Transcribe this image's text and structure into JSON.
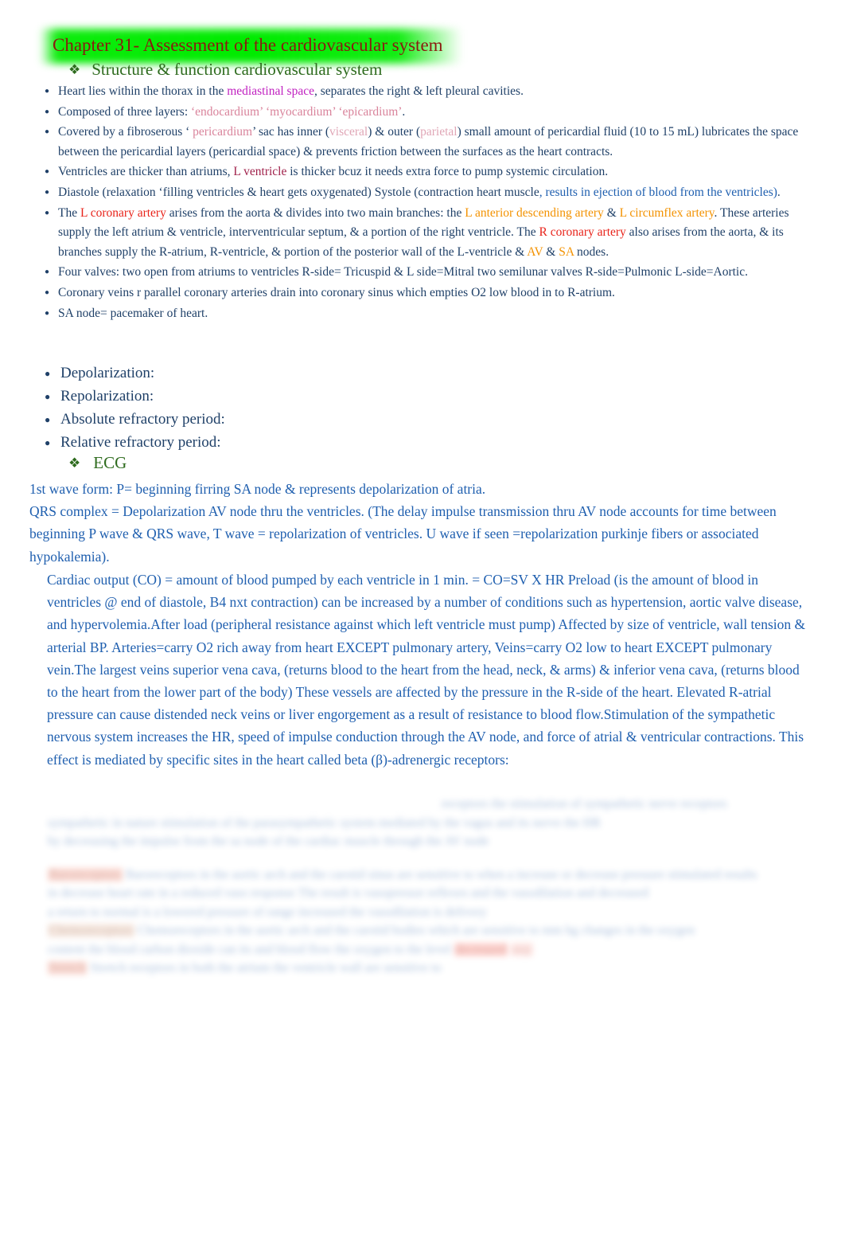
{
  "document": {
    "title": "Chapter 31-  Assessment of the cardiovascular system",
    "title_text_color": "#8B1A10",
    "title_highlight_color": "#00EB00",
    "body_text_color": "#1F4068",
    "paragraph_text_color": "#1F5FAF"
  },
  "headings": {
    "structure": {
      "bullet_icon": "diamond-bullet-icon",
      "label": "Structure & function cardiovascular system",
      "color": "#2E6B1E"
    },
    "ecg": {
      "bullet_icon": "diamond-bullet-icon",
      "label": "ECG",
      "color": "#2E6B1E"
    }
  },
  "bullets": [
    {
      "id": "heart-location",
      "parts": [
        {
          "text": "Heart lies within the thorax in the ",
          "color": "navy"
        },
        {
          "text": "mediastinal space",
          "color": "magenta"
        },
        {
          "text": ", separates the right & left pleural cavities.",
          "color": "navy"
        }
      ]
    },
    {
      "id": "three-layers",
      "parts": [
        {
          "text": "Composed of three layers: ",
          "color": "navy"
        },
        {
          "text": "‘endocardium’ ‘myocardium’ ‘epicardium’",
          "color": "pink"
        },
        {
          "text": ".",
          "color": "navy"
        }
      ]
    },
    {
      "id": "pericardium",
      "parts": [
        {
          "text": "Covered by a fibroserous ‘ ",
          "color": "navy"
        },
        {
          "text": "pericardium",
          "color": "pink"
        },
        {
          "text": "’ sac has inner (",
          "color": "navy"
        },
        {
          "text": "visceral",
          "color": "pink-lt"
        },
        {
          "text": ") & outer (",
          "color": "navy"
        },
        {
          "text": "parietal",
          "color": "pink-lt"
        },
        {
          "text": ") small amount of pericardial fluid (10 to 15 mL) lubricates the space between the pericardial layers (pericardial space)  & prevents friction between the surfaces as the heart contracts.",
          "color": "navy"
        }
      ]
    },
    {
      "id": "ventricles-thicker",
      "parts": [
        {
          "text": "Ventricles are thicker than atriums, ",
          "color": "navy"
        },
        {
          "text": "L ventricle",
          "color": "maroon"
        },
        {
          "text": "  is thicker bcuz it needs extra force to pump systemic circulation.",
          "color": "navy"
        }
      ]
    },
    {
      "id": "diastole-systole",
      "parts": [
        {
          "text": "Diastole  (relaxation ‘filling ventricles & heart gets oxygenated) Systole (contraction heart muscle",
          "color": "navy"
        },
        {
          "text": ", results in ejection of blood from the ventricles)",
          "color": "blue"
        },
        {
          "text": ".",
          "color": "navy"
        }
      ]
    },
    {
      "id": "coronary-arteries",
      "parts": [
        {
          "text": "The ",
          "color": "navy"
        },
        {
          "text": "L  coronary artery",
          "color": "red"
        },
        {
          "text": " arises from the aorta & divides into two main branches: the ",
          "color": "navy"
        },
        {
          "text": "L anterior descending artery",
          "color": "orange"
        },
        {
          "text": " & ",
          "color": "navy"
        },
        {
          "text": "L  circumflex artery",
          "color": "orange"
        },
        {
          "text": ". These arteries supply the left atrium & ventricle, interventricular septum, & a portion of the right ventricle. The ",
          "color": "navy"
        },
        {
          "text": "R coronary artery",
          "color": "red"
        },
        {
          "text": " also arises from the aorta, & its branches supply the R-atrium, R-ventricle, & portion of the posterior wall of the L-ventricle &   ",
          "color": "navy"
        },
        {
          "text": "AV",
          "color": "orange"
        },
        {
          "text": " & ",
          "color": "navy"
        },
        {
          "text": "SA",
          "color": "orange"
        },
        {
          "text": " nodes.",
          "color": "navy"
        }
      ]
    },
    {
      "id": "four-valves",
      "parts": [
        {
          "text": "Four valves: two open from atriums to ventricles R-side= Tricuspid & L side=Mitral two semilunar valves R-side=Pulmonic L-side=Aortic.",
          "color": "navy"
        }
      ]
    },
    {
      "id": "coronary-veins",
      "parts": [
        {
          "text": "Coronary veins r parallel coronary arteries drain into coronary sinus which empties O2 low blood in to R-atrium.",
          "color": "navy"
        }
      ]
    },
    {
      "id": "sa-node",
      "parts": [
        {
          "text": "SA node= pacemaker of heart.",
          "color": "navy"
        }
      ]
    }
  ],
  "big_bullets": [
    {
      "id": "depolarization",
      "label": " Depolarization:"
    },
    {
      "id": "repolarization",
      "label": "Repolarization:"
    },
    {
      "id": "absolute-refractory-period",
      "label": "Absolute refractory period:"
    },
    {
      "id": "relative-refractory-period",
      "label": "Relative refractory period:"
    }
  ],
  "paragraphs": {
    "ecg_waveforms": "1st wave form: P= beginning firring  SA node & represents depolarization of atria. QRS  complex = Depolarization AV node thru the ventricles. (The delay impulse transmission thru AV node accounts for time between beginning P wave & QRS wave, T wave = repolarization of ventricles. U wave if seen =repolarization purkinje fibers or associated hypokalemia).",
    "ecg_line1": "1st wave form: P= beginning firring  SA node & represents depolarization of atria.",
    "ecg_line2": "QRS  complex = Depolarization AV node thru the ventricles. (The delay impulse transmission thru AV node accounts for time between beginning P wave & QRS wave, T wave = repolarization of ventricles. U wave if seen =repolarization purkinje fibers or associated hypokalemia).",
    "cardiac_output": "Cardiac output  (CO) = amount of blood pumped by each ventricle in 1 min. = CO=SV X HR Preload  (is the amount of blood in ventricles @ end of diastole, B4 nxt contraction) can be increased by a number of conditions such as hypertension, aortic valve disease, and hypervolemia.After load  (peripheral resistance against which left ventricle must pump) Affected by size of ventricle, wall tension & arterial BP. Arteries=carry O2 rich away from heart EXCEPT pulmonary artery, Veins=carry O2 low to heart EXCEPT pulmonary vein.The largest veins superior vena cava, (returns blood to the heart from the head, neck, & arms) & inferior vena cava, (returns blood to the heart from the lower part of the body) These vessels are affected by the pressure in the R-side of the heart. Elevated R-atrial pressure can cause distended neck veins or liver engorgement as a result of resistance to blood flow.Stimulation of the sympathetic nervous system increases the HR, speed of impulse conduction through the AV node, and force of atrial & ventricular contractions. This effect is mediated by specific sites in the heart called beta (β)-adrenergic receptors:"
  },
  "blurred_section": {
    "note": "illegible blurred/redacted text at bottom of page",
    "lines": [
      "receptors the stimulation of sympathetic nerve receptors",
      "sympathetic in nature  stimulation of the parasympathetic system mediated by the  vagus and its nerve the HR",
      "by decreasing the impulse from the sa node of the cardiac muscle through the AV node",
      "Baroreceptors in the aortic arch and the carotid sinus are sensitive to when a increase or decrease pressure stimulated results",
      "in decrease heart rate in a reduced  vaso response The result is vasopressor reflexes and the vasodilation and decreased",
      "a return to normal is a lowered pressure  of range  increased the vasodilation  is delivery",
      "Chemoreceptors in the aortic arch  and the carotid bodies which are sensitive to mm hg  changes in the oxygen",
      "content the  blood  carbon  dioxide  can  its  and  blood  flow  the  oxygen  to  the  level",
      "Stretch receptors in both the atrium the ventricle wall are sensitive to"
    ]
  }
}
